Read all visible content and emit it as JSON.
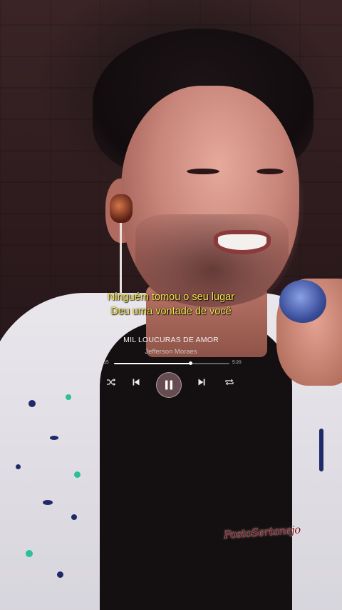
{
  "lyrics": {
    "line1": "Ninguém tomou o seu lugar",
    "line2": "Deu uma vontade de você"
  },
  "player": {
    "title": "MIL LOUCURAS DE AMOR",
    "artist": "Jefferson Moraes",
    "elapsed": "2:15",
    "total": "5:20",
    "progress": 0.66,
    "state": "playing",
    "icons": [
      "shuffle-icon",
      "previous-icon",
      "pause-icon",
      "next-icon",
      "repeat-icon"
    ]
  },
  "watermark": {
    "text": "PostoSertanejo"
  },
  "colors": {
    "lyrics": "#f4e34a",
    "watermark": "#7a0a10"
  }
}
